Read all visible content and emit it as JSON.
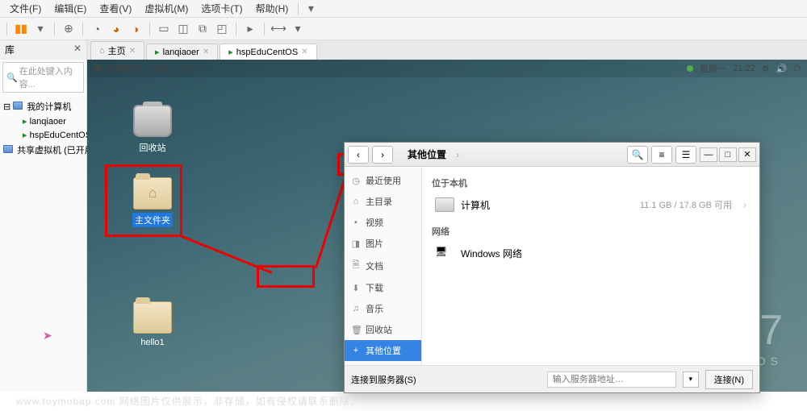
{
  "menubar": [
    "文件(F)",
    "编辑(E)",
    "查看(V)",
    "虚拟机(M)",
    "选项卡(T)",
    "帮助(H)"
  ],
  "sidebar": {
    "title": "库",
    "search_placeholder": "在此处键入内容...",
    "root": "我的计算机",
    "items": [
      "lanqiaoer",
      "hspEduCentOS"
    ],
    "shared": "共享虚拟机 (已开用)"
  },
  "tabs": [
    {
      "icon": "home",
      "label": "主页"
    },
    {
      "icon": "vm",
      "label": "lanqiaoer"
    },
    {
      "icon": "vm",
      "label": "hspEduCentOS"
    }
  ],
  "gnome": {
    "apps": "应用程序",
    "places": "位置",
    "files": "文件",
    "day": "星期一",
    "time": "21:22"
  },
  "desktop_icons": {
    "trash": "回收站",
    "home": "主文件夹",
    "hello": "hello1"
  },
  "filewin": {
    "breadcrumb": "其他位置",
    "sidebar": [
      {
        "icon": "◷",
        "label": "最近使用"
      },
      {
        "icon": "⌂",
        "label": "主目录"
      },
      {
        "icon": "▪",
        "label": "视频"
      },
      {
        "icon": "◨",
        "label": "图片"
      },
      {
        "icon": "🗎",
        "label": "文档"
      },
      {
        "icon": "⬇",
        "label": "下载"
      },
      {
        "icon": "♫",
        "label": "音乐"
      },
      {
        "icon": "🗑",
        "label": "回收站"
      },
      {
        "icon": "+",
        "label": "其他位置",
        "active": true
      }
    ],
    "section1": "位于本机",
    "computer": "计算机",
    "disk_info": "11.1 GB / 17.8 GB 可用",
    "section2": "网络",
    "windows_net": "Windows 网络",
    "footer_label": "连接到服务器(S)",
    "footer_placeholder": "输入服务器地址…",
    "connect_btn": "连接(N)"
  },
  "centos": {
    "ver": "7",
    "name": "CENTOS"
  },
  "watermark": "www.toymobap.com 网络图片仅供展示，非存储，如有侵权请联系删除。"
}
